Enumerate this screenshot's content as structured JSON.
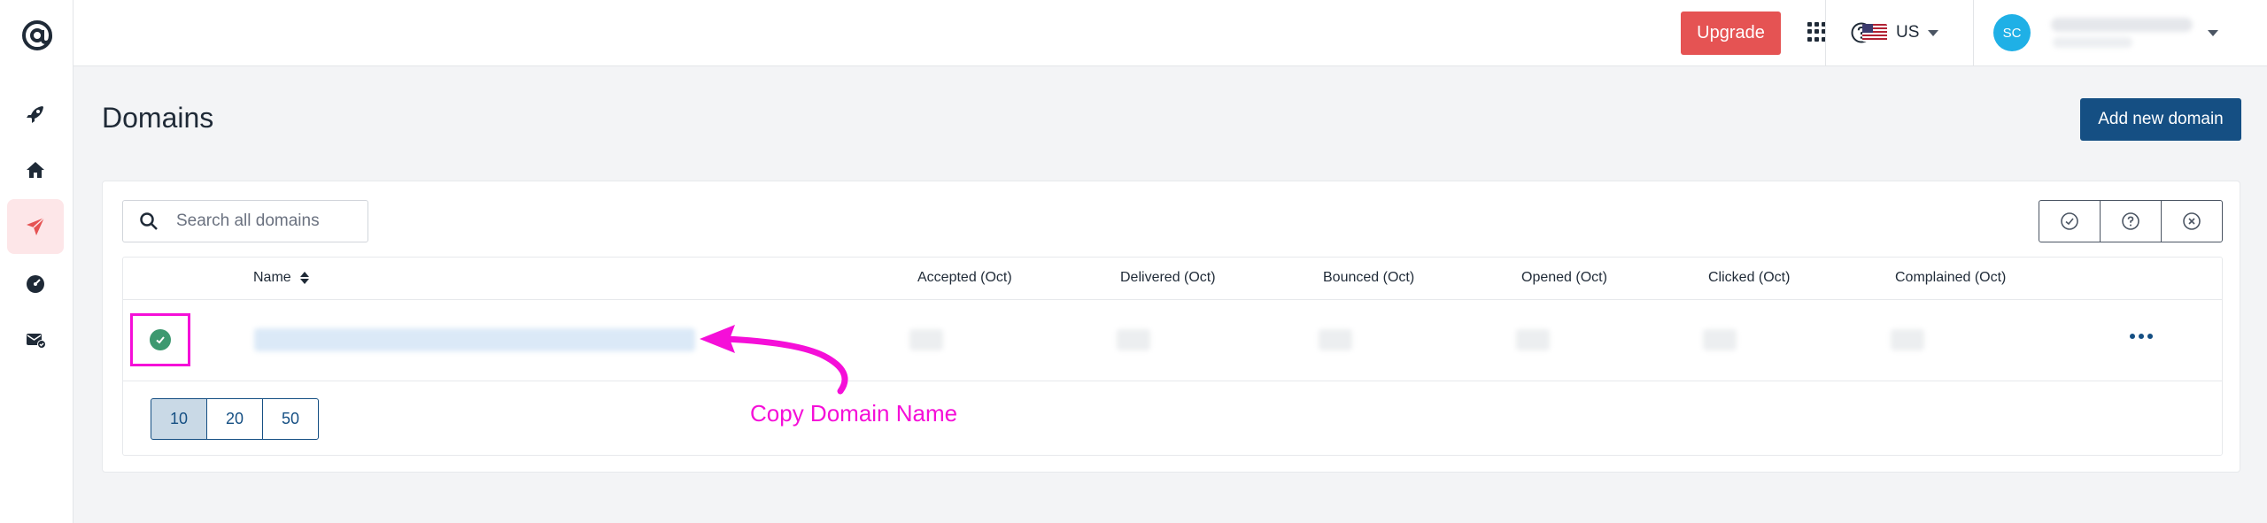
{
  "topbar": {
    "upgrade_label": "Upgrade",
    "region_label": "US",
    "avatar_initials": "SC"
  },
  "page": {
    "title": "Domains",
    "add_button_label": "Add new domain"
  },
  "search": {
    "placeholder": "Search all domains"
  },
  "table": {
    "columns": [
      "Name",
      "Accepted (Oct)",
      "Delivered (Oct)",
      "Bounced (Oct)",
      "Opened (Oct)",
      "Clicked (Oct)",
      "Complained (Oct)"
    ],
    "row_status": "verified"
  },
  "pagination": {
    "sizes": [
      "10",
      "20",
      "50"
    ],
    "selected": "10"
  },
  "annotation": {
    "text": "Copy Domain Name",
    "color": "#f50fd8"
  },
  "colors": {
    "upgrade": "#e55353",
    "primary": "#154f83",
    "status_ok": "#3d9970",
    "sidebar_active": "#fde6e8",
    "avatar": "#1fb0e6"
  },
  "icons": {
    "sidebar": [
      "rocket-icon",
      "home-icon",
      "send-icon",
      "dashboard-gauge-icon",
      "mail-check-icon"
    ],
    "filters": [
      "check-circle-icon",
      "question-circle-icon",
      "x-circle-icon"
    ]
  }
}
